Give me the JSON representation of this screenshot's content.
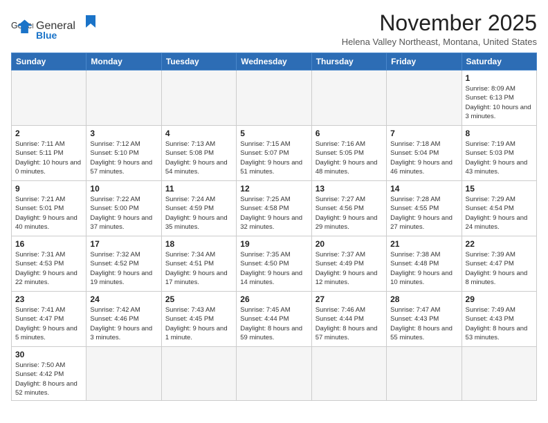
{
  "header": {
    "logo_general": "General",
    "logo_blue": "Blue",
    "month_title": "November 2025",
    "subtitle": "Helena Valley Northeast, Montana, United States"
  },
  "weekdays": [
    "Sunday",
    "Monday",
    "Tuesday",
    "Wednesday",
    "Thursday",
    "Friday",
    "Saturday"
  ],
  "weeks": [
    [
      {
        "day": "",
        "info": ""
      },
      {
        "day": "",
        "info": ""
      },
      {
        "day": "",
        "info": ""
      },
      {
        "day": "",
        "info": ""
      },
      {
        "day": "",
        "info": ""
      },
      {
        "day": "",
        "info": ""
      },
      {
        "day": "1",
        "info": "Sunrise: 8:09 AM\nSunset: 6:13 PM\nDaylight: 10 hours and 3 minutes."
      }
    ],
    [
      {
        "day": "2",
        "info": "Sunrise: 7:11 AM\nSunset: 5:11 PM\nDaylight: 10 hours and 0 minutes."
      },
      {
        "day": "3",
        "info": "Sunrise: 7:12 AM\nSunset: 5:10 PM\nDaylight: 9 hours and 57 minutes."
      },
      {
        "day": "4",
        "info": "Sunrise: 7:13 AM\nSunset: 5:08 PM\nDaylight: 9 hours and 54 minutes."
      },
      {
        "day": "5",
        "info": "Sunrise: 7:15 AM\nSunset: 5:07 PM\nDaylight: 9 hours and 51 minutes."
      },
      {
        "day": "6",
        "info": "Sunrise: 7:16 AM\nSunset: 5:05 PM\nDaylight: 9 hours and 48 minutes."
      },
      {
        "day": "7",
        "info": "Sunrise: 7:18 AM\nSunset: 5:04 PM\nDaylight: 9 hours and 46 minutes."
      },
      {
        "day": "8",
        "info": "Sunrise: 7:19 AM\nSunset: 5:03 PM\nDaylight: 9 hours and 43 minutes."
      }
    ],
    [
      {
        "day": "9",
        "info": "Sunrise: 7:21 AM\nSunset: 5:01 PM\nDaylight: 9 hours and 40 minutes."
      },
      {
        "day": "10",
        "info": "Sunrise: 7:22 AM\nSunset: 5:00 PM\nDaylight: 9 hours and 37 minutes."
      },
      {
        "day": "11",
        "info": "Sunrise: 7:24 AM\nSunset: 4:59 PM\nDaylight: 9 hours and 35 minutes."
      },
      {
        "day": "12",
        "info": "Sunrise: 7:25 AM\nSunset: 4:58 PM\nDaylight: 9 hours and 32 minutes."
      },
      {
        "day": "13",
        "info": "Sunrise: 7:27 AM\nSunset: 4:56 PM\nDaylight: 9 hours and 29 minutes."
      },
      {
        "day": "14",
        "info": "Sunrise: 7:28 AM\nSunset: 4:55 PM\nDaylight: 9 hours and 27 minutes."
      },
      {
        "day": "15",
        "info": "Sunrise: 7:29 AM\nSunset: 4:54 PM\nDaylight: 9 hours and 24 minutes."
      }
    ],
    [
      {
        "day": "16",
        "info": "Sunrise: 7:31 AM\nSunset: 4:53 PM\nDaylight: 9 hours and 22 minutes."
      },
      {
        "day": "17",
        "info": "Sunrise: 7:32 AM\nSunset: 4:52 PM\nDaylight: 9 hours and 19 minutes."
      },
      {
        "day": "18",
        "info": "Sunrise: 7:34 AM\nSunset: 4:51 PM\nDaylight: 9 hours and 17 minutes."
      },
      {
        "day": "19",
        "info": "Sunrise: 7:35 AM\nSunset: 4:50 PM\nDaylight: 9 hours and 14 minutes."
      },
      {
        "day": "20",
        "info": "Sunrise: 7:37 AM\nSunset: 4:49 PM\nDaylight: 9 hours and 12 minutes."
      },
      {
        "day": "21",
        "info": "Sunrise: 7:38 AM\nSunset: 4:48 PM\nDaylight: 9 hours and 10 minutes."
      },
      {
        "day": "22",
        "info": "Sunrise: 7:39 AM\nSunset: 4:47 PM\nDaylight: 9 hours and 8 minutes."
      }
    ],
    [
      {
        "day": "23",
        "info": "Sunrise: 7:41 AM\nSunset: 4:47 PM\nDaylight: 9 hours and 5 minutes."
      },
      {
        "day": "24",
        "info": "Sunrise: 7:42 AM\nSunset: 4:46 PM\nDaylight: 9 hours and 3 minutes."
      },
      {
        "day": "25",
        "info": "Sunrise: 7:43 AM\nSunset: 4:45 PM\nDaylight: 9 hours and 1 minute."
      },
      {
        "day": "26",
        "info": "Sunrise: 7:45 AM\nSunset: 4:44 PM\nDaylight: 8 hours and 59 minutes."
      },
      {
        "day": "27",
        "info": "Sunrise: 7:46 AM\nSunset: 4:44 PM\nDaylight: 8 hours and 57 minutes."
      },
      {
        "day": "28",
        "info": "Sunrise: 7:47 AM\nSunset: 4:43 PM\nDaylight: 8 hours and 55 minutes."
      },
      {
        "day": "29",
        "info": "Sunrise: 7:49 AM\nSunset: 4:43 PM\nDaylight: 8 hours and 53 minutes."
      }
    ],
    [
      {
        "day": "30",
        "info": "Sunrise: 7:50 AM\nSunset: 4:42 PM\nDaylight: 8 hours and 52 minutes."
      },
      {
        "day": "",
        "info": ""
      },
      {
        "day": "",
        "info": ""
      },
      {
        "day": "",
        "info": ""
      },
      {
        "day": "",
        "info": ""
      },
      {
        "day": "",
        "info": ""
      },
      {
        "day": "",
        "info": ""
      }
    ]
  ]
}
